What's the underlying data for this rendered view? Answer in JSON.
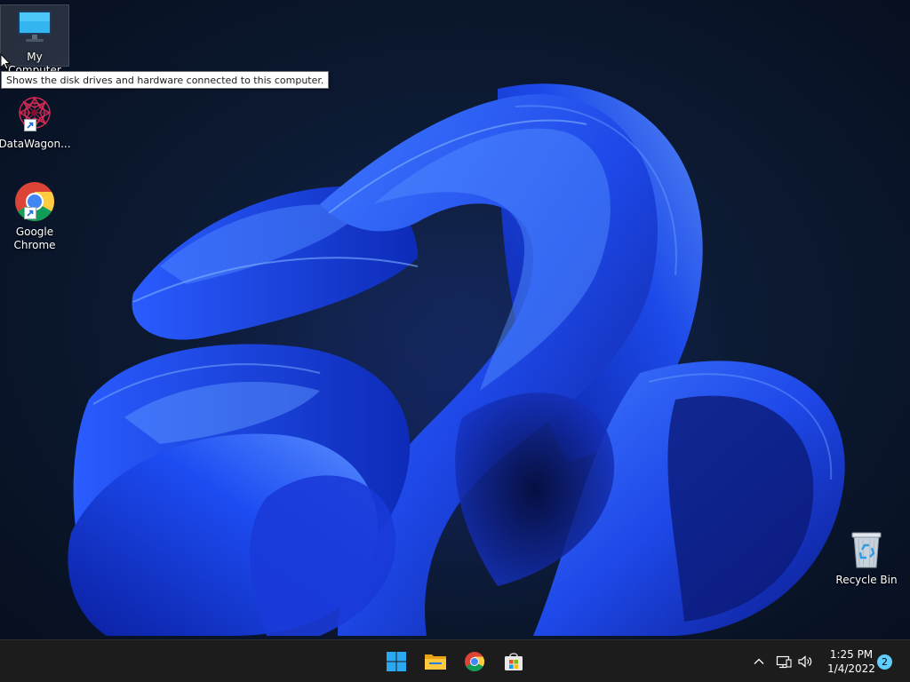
{
  "desktop": {
    "icons": [
      {
        "label": "My Computer",
        "icon": "monitor-icon"
      },
      {
        "label": "DataWagon...",
        "icon": "datawagon-logo-icon",
        "shortcut": true
      },
      {
        "label": "Google Chrome",
        "icon": "chrome-icon",
        "shortcut": true
      },
      {
        "label": "Recycle Bin",
        "icon": "recycle-bin-icon"
      }
    ],
    "tooltip": "Shows the disk drives and hardware connected to this computer."
  },
  "taskbar": {
    "apps": [
      {
        "name": "Start",
        "icon": "windows-start-icon"
      },
      {
        "name": "File Explorer",
        "icon": "folder-icon"
      },
      {
        "name": "Google Chrome",
        "icon": "chrome-icon"
      },
      {
        "name": "Microsoft Store",
        "icon": "store-bag-icon"
      }
    ],
    "tray": {
      "icons": [
        "chevron-up-icon",
        "network-icon",
        "volume-icon"
      ],
      "time": "1:25 PM",
      "date": "1/4/2022",
      "notification_count": "2"
    }
  },
  "colors": {
    "accent": "#60cdff",
    "taskbar": "#1c1c1c",
    "bloom": "#1e48e8"
  }
}
